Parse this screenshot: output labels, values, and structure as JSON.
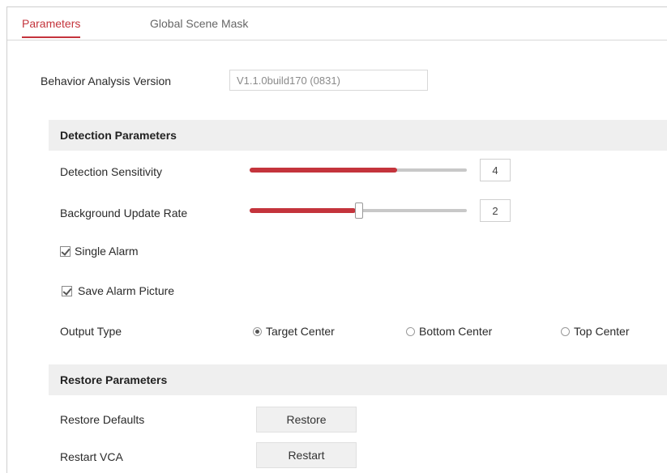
{
  "tabs": [
    {
      "label": "Parameters",
      "active": true
    },
    {
      "label": "Global Scene Mask",
      "active": false
    }
  ],
  "version": {
    "label": "Behavior Analysis Version",
    "value": "V1.1.0build170 (0831)"
  },
  "detection": {
    "title": "Detection Parameters",
    "sensitivity": {
      "label": "Detection Sensitivity",
      "value": "4",
      "level": 0.8
    },
    "background_rate": {
      "label": "Background Update Rate",
      "value": "2",
      "level": 0.5
    },
    "single_alarm": {
      "label": "Single Alarm",
      "checked": true
    },
    "save_picture": {
      "label": "Save Alarm Picture",
      "checked": true
    },
    "output_type": {
      "label": "Output Type",
      "options": [
        {
          "label": "Target Center",
          "selected": true
        },
        {
          "label": "Bottom Center",
          "selected": false
        },
        {
          "label": "Top Center",
          "selected": false
        }
      ]
    }
  },
  "restore": {
    "title": "Restore Parameters",
    "defaults": {
      "label": "Restore Defaults",
      "button": "Restore"
    },
    "vca": {
      "label": "Restart VCA",
      "button": "Restart"
    }
  },
  "colors": {
    "accent": "#c4343c",
    "section_bg": "#efefef"
  }
}
